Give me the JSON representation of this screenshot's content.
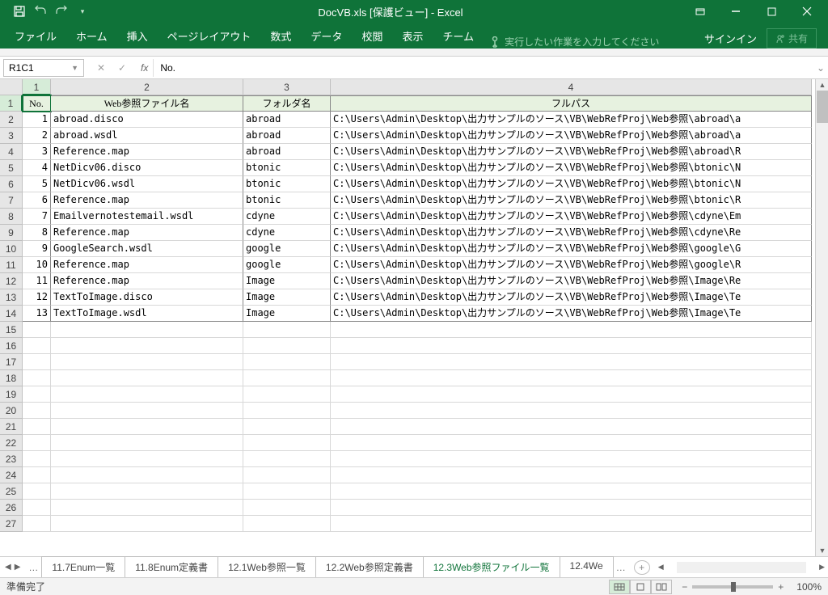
{
  "title": "DocVB.xls [保護ビュー] - Excel",
  "qat": {
    "save": "save",
    "undo": "undo",
    "redo": "redo",
    "customize": "▾"
  },
  "ribbonTabs": [
    "ファイル",
    "ホーム",
    "挿入",
    "ページレイアウト",
    "数式",
    "データ",
    "校閲",
    "表示",
    "チーム"
  ],
  "tellMe": "実行したい作業を入力してください",
  "signin": "サインイン",
  "share": "共有",
  "nameBox": "R1C1",
  "formulaValue": "No.",
  "columns": [
    "1",
    "2",
    "3",
    "4"
  ],
  "headers": {
    "c1": "No.",
    "c2": "Web参照ファイル名",
    "c3": "フォルダ名",
    "c4": "フルパス"
  },
  "rows": [
    {
      "no": "1",
      "file": "abroad.disco",
      "folder": "abroad",
      "path": "C:\\Users\\Admin\\Desktop\\出力サンプルのソース\\VB\\WebRefProj\\Web参照\\abroad\\a"
    },
    {
      "no": "2",
      "file": "abroad.wsdl",
      "folder": "abroad",
      "path": "C:\\Users\\Admin\\Desktop\\出力サンプルのソース\\VB\\WebRefProj\\Web参照\\abroad\\a"
    },
    {
      "no": "3",
      "file": "Reference.map",
      "folder": "abroad",
      "path": "C:\\Users\\Admin\\Desktop\\出力サンプルのソース\\VB\\WebRefProj\\Web参照\\abroad\\R"
    },
    {
      "no": "4",
      "file": "NetDicv06.disco",
      "folder": "btonic",
      "path": "C:\\Users\\Admin\\Desktop\\出力サンプルのソース\\VB\\WebRefProj\\Web参照\\btonic\\N"
    },
    {
      "no": "5",
      "file": "NetDicv06.wsdl",
      "folder": "btonic",
      "path": "C:\\Users\\Admin\\Desktop\\出力サンプルのソース\\VB\\WebRefProj\\Web参照\\btonic\\N"
    },
    {
      "no": "6",
      "file": "Reference.map",
      "folder": "btonic",
      "path": "C:\\Users\\Admin\\Desktop\\出力サンプルのソース\\VB\\WebRefProj\\Web参照\\btonic\\R"
    },
    {
      "no": "7",
      "file": "Emailvernotestemail.wsdl",
      "folder": "cdyne",
      "path": "C:\\Users\\Admin\\Desktop\\出力サンプルのソース\\VB\\WebRefProj\\Web参照\\cdyne\\Em"
    },
    {
      "no": "8",
      "file": "Reference.map",
      "folder": "cdyne",
      "path": "C:\\Users\\Admin\\Desktop\\出力サンプルのソース\\VB\\WebRefProj\\Web参照\\cdyne\\Re"
    },
    {
      "no": "9",
      "file": "GoogleSearch.wsdl",
      "folder": "google",
      "path": "C:\\Users\\Admin\\Desktop\\出力サンプルのソース\\VB\\WebRefProj\\Web参照\\google\\G"
    },
    {
      "no": "10",
      "file": "Reference.map",
      "folder": "google",
      "path": "C:\\Users\\Admin\\Desktop\\出力サンプルのソース\\VB\\WebRefProj\\Web参照\\google\\R"
    },
    {
      "no": "11",
      "file": "Reference.map",
      "folder": "Image",
      "path": "C:\\Users\\Admin\\Desktop\\出力サンプルのソース\\VB\\WebRefProj\\Web参照\\Image\\Re"
    },
    {
      "no": "12",
      "file": "TextToImage.disco",
      "folder": "Image",
      "path": "C:\\Users\\Admin\\Desktop\\出力サンプルのソース\\VB\\WebRefProj\\Web参照\\Image\\Te"
    },
    {
      "no": "13",
      "file": "TextToImage.wsdl",
      "folder": "Image",
      "path": "C:\\Users\\Admin\\Desktop\\出力サンプルのソース\\VB\\WebRefProj\\Web参照\\Image\\Te"
    }
  ],
  "rowNumbers": [
    "1",
    "2",
    "3",
    "4",
    "5",
    "6",
    "7",
    "8",
    "9",
    "10",
    "11",
    "12",
    "13",
    "14",
    "15",
    "16",
    "17",
    "18",
    "19",
    "20",
    "21",
    "22",
    "23",
    "24",
    "25",
    "26",
    "27"
  ],
  "sheetTabs": [
    "11.7Enum一覧",
    "11.8Enum定義書",
    "12.1Web参照一覧",
    "12.2Web参照定義書",
    "12.3Web参照ファイル一覧",
    "12.4We"
  ],
  "activeSheet": 4,
  "status": "準備完了",
  "zoom": "100%"
}
